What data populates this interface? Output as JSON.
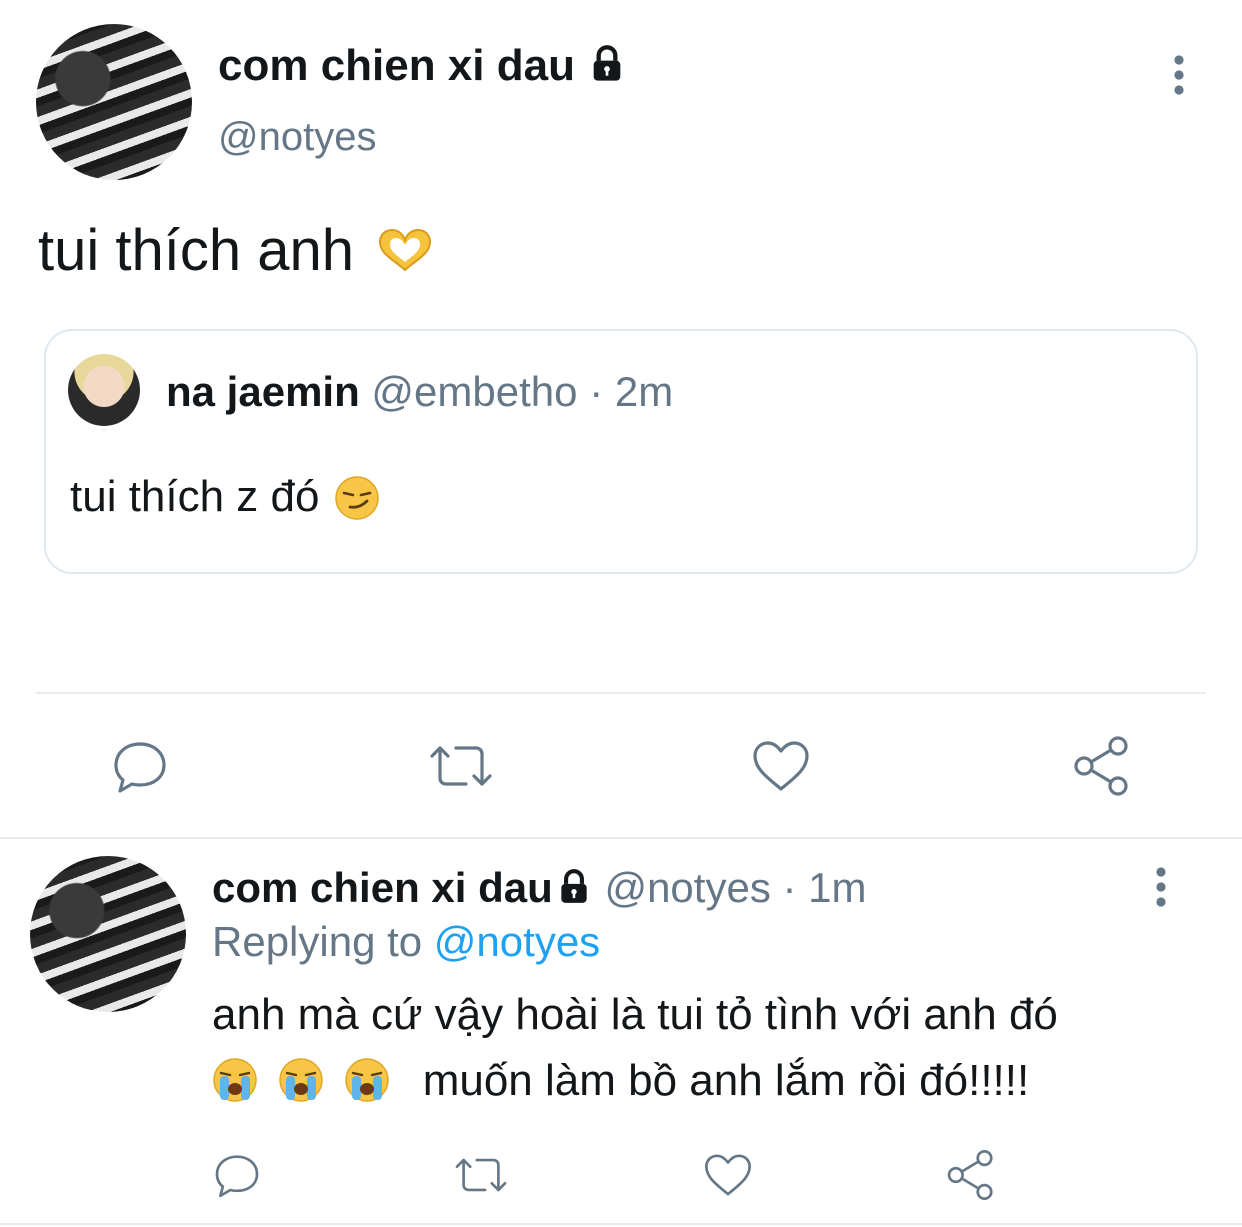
{
  "main_tweet": {
    "display_name": "com chien xi dau",
    "handle": "@notyes",
    "text": "tui thích anh",
    "emoji": "heart-hands-emoji"
  },
  "quoted_tweet": {
    "display_name": "na jaemin",
    "handle": "@embetho",
    "separator": "·",
    "time": "2m",
    "text": "tui thích z đó",
    "emoji": "smirking-face-emoji"
  },
  "reply_tweet": {
    "display_name": "com chien xi dau",
    "handle": "@notyes",
    "separator": "·",
    "time": "1m",
    "replying_prefix": "Replying to",
    "replying_handle": "@notyes",
    "text_line1": "anh mà cứ vậy hoài là tui tỏ tình với anh đó",
    "text_line2": "muốn làm bồ anh lắm rồi đó!!!!!",
    "emojis": [
      "loudly-crying-face-emoji",
      "loudly-crying-face-emoji",
      "loudly-crying-face-emoji"
    ]
  },
  "icons": [
    "lock-icon",
    "more-icon",
    "reply-icon",
    "retweet-icon",
    "like-icon",
    "share-icon"
  ],
  "colors": {
    "text": "#14171a",
    "muted": "#657786",
    "link": "#1da1f2",
    "border": "#e1e8ed"
  }
}
